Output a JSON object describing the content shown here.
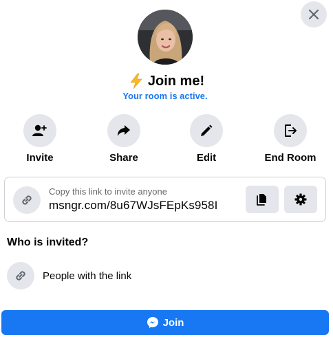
{
  "dialog": {
    "title": "Join me!",
    "title_icon": "lightning-bolt-icon",
    "subtitle": "Your room is active.",
    "accent_color": "#1877f2"
  },
  "actions": [
    {
      "label": "Invite",
      "icon": "add-person-icon"
    },
    {
      "label": "Share",
      "icon": "share-arrow-icon"
    },
    {
      "label": "Edit",
      "icon": "pencil-icon"
    },
    {
      "label": "End Room",
      "icon": "exit-icon"
    }
  ],
  "link_card": {
    "hint": "Copy this link to invite anyone",
    "url": "msngr.com/8u67WJsFEpKs958I",
    "copy_icon": "copy-icon",
    "settings_icon": "gear-icon"
  },
  "invited": {
    "heading": "Who is invited?",
    "option_label": "People with the link",
    "option_icon": "link-icon"
  },
  "join_button": {
    "label": "Join",
    "icon": "messenger-icon",
    "color": "#1877f2"
  }
}
